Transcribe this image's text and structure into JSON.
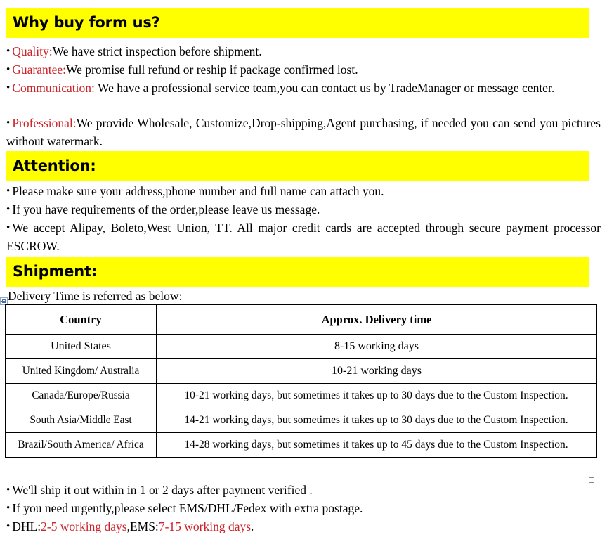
{
  "sections": {
    "why": {
      "header": "Why buy form us?",
      "bullets": [
        {
          "keyword": "Quality:",
          "text": "We have strict inspection before shipment."
        },
        {
          "keyword": "Guarantee:",
          "text": "We promise full refund or reship if package confirmed lost."
        },
        {
          "keyword": "Communication:",
          "text": " We have a professional service team,you can contact us by TradeManager or message center."
        },
        {
          "keyword": "Professional:",
          "text": "We provide Wholesale, Customize,Drop-shipping,Agent purchasing, if needed you can send you pictures without watermark."
        }
      ]
    },
    "attention": {
      "header": "Attention:",
      "bullets": [
        {
          "keyword": "",
          "text": "Please make sure your address,phone number and full name can attach you."
        },
        {
          "keyword": "",
          "text": "If you have requirements of the order,please leave us message."
        },
        {
          "keyword": "",
          "text": "We accept Alipay, Boleto,West Union, TT. All major credit cards are accepted through secure payment processor ESCROW."
        }
      ]
    },
    "shipment": {
      "header": "Shipment:",
      "intro": "Delivery Time is referred as below:",
      "table": {
        "columns": [
          "Country",
          "Approx. Delivery time"
        ],
        "rows": [
          {
            "country": "United States",
            "time": "8-15 working days"
          },
          {
            "country": "United Kingdom/ Australia",
            "time": "10-21 working days"
          },
          {
            "country": "Canada/Europe/Russia",
            "time": "10-21 working days, but sometimes it takes up to 30 days due to the Custom Inspection."
          },
          {
            "country": "South Asia/Middle East",
            "time": "14-21 working days, but sometimes it takes up to 30 days due to the Custom Inspection."
          },
          {
            "country": "Brazil/South America/ Africa",
            "time": "14-28 working days, but sometimes it takes up to 45 days due to the Custom Inspection."
          }
        ]
      },
      "bullets": [
        {
          "prefix": "We'll ship it out within in 1 or 2 days after payment verified .",
          "parts": []
        },
        {
          "prefix": "If you need urgently,please select EMS/DHL/Fedex with extra postage.",
          "parts": []
        }
      ],
      "dhl_line": {
        "label1": "DHL:",
        "value1": "2-5 working days",
        "sep": ",",
        "label2": "EMS:",
        "value2": "7-15 working days",
        "end": "."
      }
    }
  },
  "bullet_glyph": "•",
  "colors": {
    "highlight": "#FFFF00",
    "keyword": "#CC2229",
    "text": "#000000",
    "table_border": "#000000"
  },
  "table_handles": {
    "move_handle": "table-move-handle",
    "resize_handle": "table-resize-handle"
  }
}
